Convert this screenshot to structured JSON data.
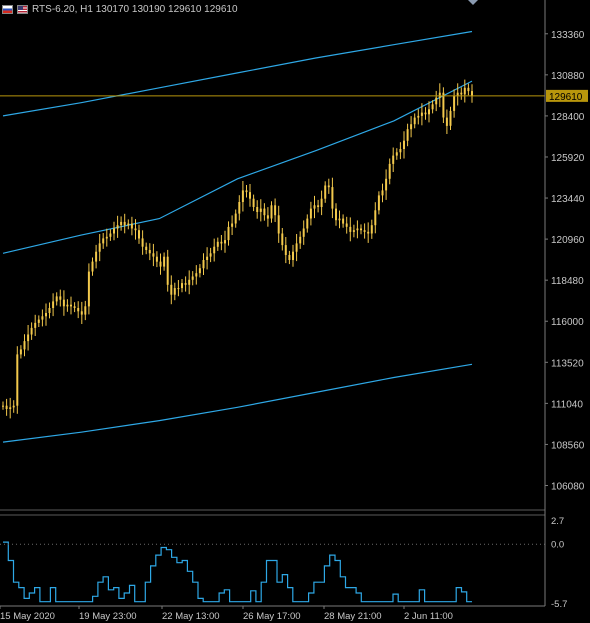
{
  "header": {
    "symbol_line": "RTS-6.20, H1  130170 130190 129610 129610",
    "icons": [
      "ru-flag-icon",
      "us-flag-icon"
    ]
  },
  "colors": {
    "background": "#000000",
    "grid": "#3a3a3a",
    "axis_text": "#c8c8c8",
    "candle": "#f2c94c",
    "envelope": "#2ea8e6",
    "price_line": "#b8960c",
    "oscillator": "#2ea8e6"
  },
  "chart_data": [
    {
      "type": "candlestick",
      "panel": "main",
      "title": "",
      "xlabel": "",
      "ylabel": "",
      "ylim": [
        104600,
        135400
      ],
      "grid": false,
      "y_ticks": [
        133360,
        130880,
        128400,
        125920,
        123440,
        120960,
        118480,
        116000,
        113520,
        111040,
        108560,
        106080
      ],
      "current_price": 129610,
      "current_price_label": "129610",
      "ohlc_last": {
        "open": 130170,
        "high": 130190,
        "low": 129610,
        "close": 129610
      },
      "close_series": [
        110900,
        110700,
        110800,
        110900,
        114000,
        114300,
        114800,
        115200,
        115600,
        115900,
        116100,
        116300,
        116500,
        116800,
        117200,
        117500,
        117300,
        116900,
        117000,
        116900,
        116800,
        116600,
        116400,
        116900,
        119000,
        119600,
        120200,
        120700,
        121000,
        121100,
        121300,
        121600,
        121800,
        122000,
        121800,
        121900,
        121600,
        121500,
        121000,
        120500,
        120300,
        120100,
        119900,
        119600,
        119300,
        119900,
        118200,
        117600,
        118000,
        118000,
        118300,
        118200,
        118500,
        118700,
        118900,
        119200,
        119700,
        119900,
        120100,
        120500,
        120800,
        120700,
        120900,
        121700,
        121900,
        122500,
        123200,
        123900,
        123800,
        123400,
        122900,
        122600,
        122800,
        122400,
        122200,
        123000,
        122400,
        121300,
        120600,
        120000,
        119700,
        120200,
        120700,
        121100,
        121600,
        122200,
        122800,
        123000,
        122900,
        123400,
        124200,
        124100,
        122800,
        122100,
        122200,
        121900,
        121700,
        121400,
        121500,
        121600,
        121500,
        121400,
        121300,
        121800,
        122700,
        123600,
        123900,
        124600,
        125500,
        126000,
        126200,
        126400,
        126900,
        127600,
        127900,
        128300,
        128400,
        128600,
        128500,
        128800,
        129100,
        129500,
        129800,
        128300,
        127800,
        128700,
        129600,
        129800,
        129700,
        130100,
        129900,
        129610
      ],
      "envelope_upper": {
        "name": "",
        "values": [
          128400,
          129200,
          130100,
          131000,
          131900,
          132700,
          133500
        ]
      },
      "envelope_middle": {
        "name": "",
        "values": [
          120100,
          121200,
          122200,
          124600,
          126300,
          128100,
          130500
        ]
      },
      "envelope_lower": {
        "name": "",
        "values": [
          108700,
          109300,
          110000,
          110800,
          111700,
          112600,
          113400
        ]
      }
    },
    {
      "type": "line",
      "panel": "oscillator",
      "title": "",
      "xlabel": "",
      "ylabel": "",
      "ylim": [
        -5.7,
        2.7
      ],
      "y_ticks": [
        2.7,
        0.0,
        -5.7
      ],
      "zero_line": 0.0,
      "values": [
        0.2,
        -1.5,
        -3.5,
        -4.0,
        -5.0,
        -4.5,
        -4.0,
        -5.3,
        -5.3,
        -4.0,
        -5.3,
        -5.3,
        -5.3,
        -5.3,
        -5.3,
        -5.3,
        -5.3,
        -4.8,
        -3.5,
        -3.0,
        -4.2,
        -4.0,
        -5.0,
        -4.5,
        -3.8,
        -5.3,
        -5.3,
        -3.5,
        -2.0,
        -1.0,
        -0.3,
        -0.5,
        -1.2,
        -1.7,
        -1.5,
        -2.5,
        -3.5,
        -5.0,
        -5.3,
        -5.3,
        -5.3,
        -4.5,
        -4.2,
        -5.3,
        -5.3,
        -5.3,
        -5.3,
        -4.3,
        -5.3,
        -3.5,
        -1.5,
        -1.5,
        -3.5,
        -2.8,
        -4.0,
        -5.3,
        -5.3,
        -5.3,
        -4.5,
        -3.5,
        -3.5,
        -2.0,
        -1.0,
        -1.5,
        -3.0,
        -4.0,
        -4.0,
        -4.5,
        -5.3,
        -5.3,
        -5.3,
        -5.3,
        -5.3,
        -5.3,
        -4.6,
        -5.3,
        -5.3,
        -5.3,
        -5.3,
        -4.2,
        -5.3,
        -5.3,
        -5.3,
        -5.3,
        -5.3,
        -5.3,
        -4.0,
        -4.4,
        -5.3,
        -5.3
      ]
    }
  ],
  "x_axis": {
    "labels": [
      "15 May 2020",
      "19 May 23:00",
      "22 May 13:00",
      "26 May 17:00",
      "28 May 21:00",
      "2 Jun 11:00"
    ]
  }
}
